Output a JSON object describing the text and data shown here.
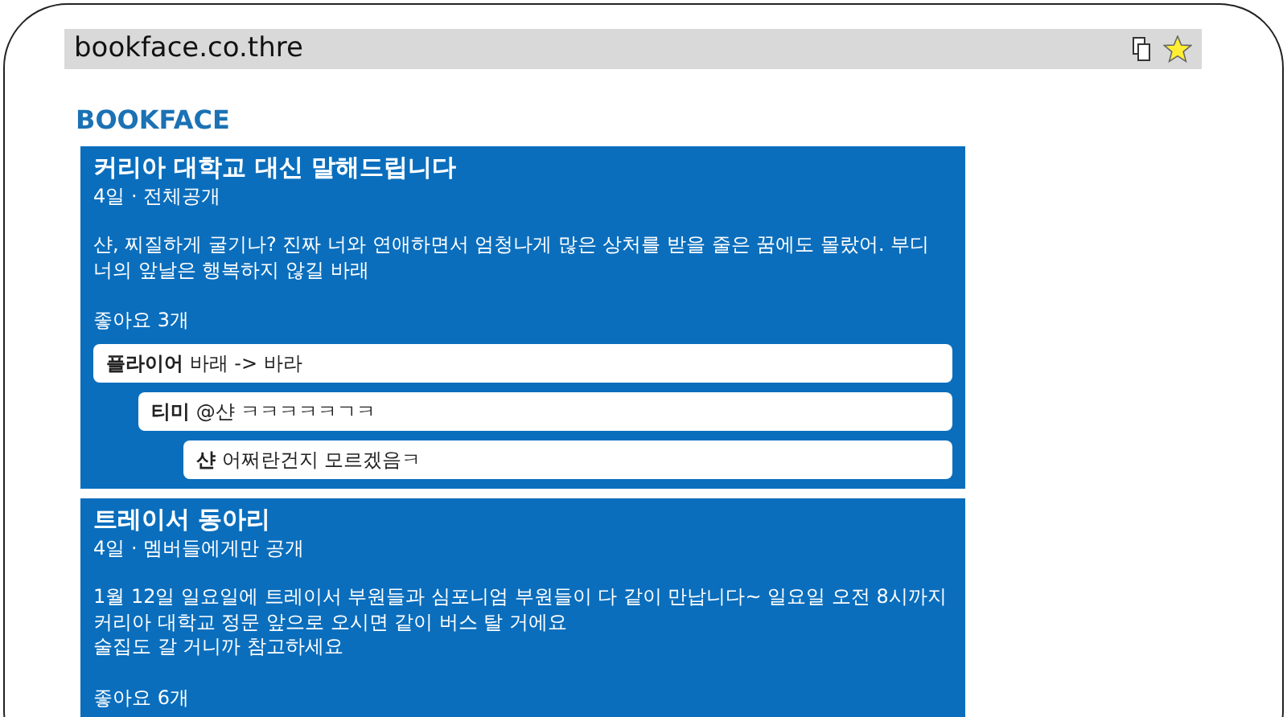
{
  "address_bar": {
    "url": "bookface.co.thre"
  },
  "site_title": "BOOKFACE",
  "posts": [
    {
      "title": "커리아 대학교 대신 말해드립니다",
      "meta": "4일 · 전체공개",
      "body": "샨, 찌질하게 굴기나? 진짜 너와 연애하면서 엄청나게 많은 상처를 받을 줄은 꿈에도 몰랐어. 부디 너의 앞날은 행복하지 않길 바래",
      "likes": "좋아요 3개",
      "comments": [
        {
          "author": "플라이어",
          "text": "바래 -> 바라",
          "children": [
            {
              "author": "티미",
              "text": "@샨 ㅋㅋㅋㅋㅋㄱㅋ",
              "children": [
                {
                  "author": "샨",
                  "text": "어쩌란건지 모르겠음ㅋ"
                }
              ]
            }
          ]
        }
      ]
    },
    {
      "title": "트레이서 동아리",
      "meta": "4일 · 멤버들에게만 공개",
      "body": "1월 12일 일요일에 트레이서 부원들과 심포니엄 부원들이 다 같이 만납니다~ 일요일 오전 8시까지 커리아 대학교 정문 앞으로 오시면 같이 버스 탈 거에요\n술집도 갈 거니까 참고하세요",
      "likes": "좋아요 6개"
    }
  ]
}
